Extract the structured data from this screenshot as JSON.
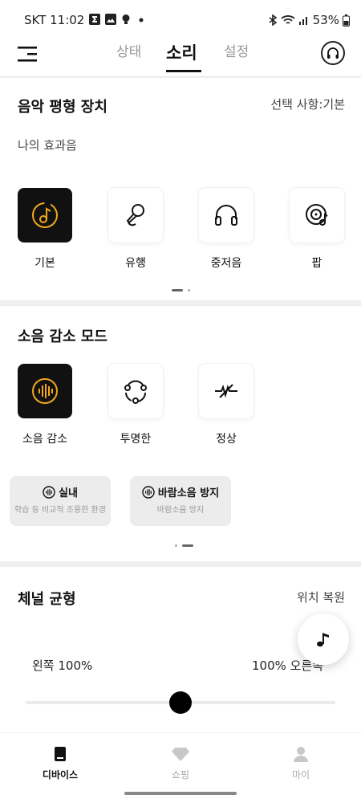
{
  "status_bar": {
    "time": "SKT 11:02",
    "battery": "53%"
  },
  "header": {
    "tabs": [
      {
        "label": "상태",
        "active": false
      },
      {
        "label": "소리",
        "active": true
      },
      {
        "label": "설정",
        "active": false
      }
    ]
  },
  "equalizer": {
    "title": "음악 평형 장치",
    "selection": "선택 사항:기본",
    "subtitle": "나의 효과음",
    "presets": [
      {
        "label": "기본",
        "icon": "music-disc-icon",
        "active": true
      },
      {
        "label": "유행",
        "icon": "microphone-icon",
        "active": false
      },
      {
        "label": "중저음",
        "icon": "headphones-icon",
        "active": false
      },
      {
        "label": "팝",
        "icon": "vinyl-icon",
        "active": false
      }
    ]
  },
  "noise": {
    "title": "소음 감소 모드",
    "modes": [
      {
        "label": "소음 감소",
        "icon": "noise-cancel-icon",
        "active": true
      },
      {
        "label": "투명한",
        "icon": "transparency-icon",
        "active": false
      },
      {
        "label": "정상",
        "icon": "normal-icon",
        "active": false
      }
    ],
    "chips": [
      {
        "title": "실내",
        "subtitle": "학습 등 비교적 조용한 환경"
      },
      {
        "title": "바람소음 방지",
        "subtitle": "바람소음 방지"
      }
    ]
  },
  "balance": {
    "title": "체널 균형",
    "reset": "위치 복원",
    "left": "왼쪽 100%",
    "right": "100% 오른쪽",
    "value": 0.5
  },
  "bottom_nav": [
    {
      "label": "디바이스",
      "active": true
    },
    {
      "label": "쇼핑",
      "active": false
    },
    {
      "label": "마이",
      "active": false
    }
  ],
  "colors": {
    "accent": "#f2a81d",
    "dark": "#111111"
  }
}
